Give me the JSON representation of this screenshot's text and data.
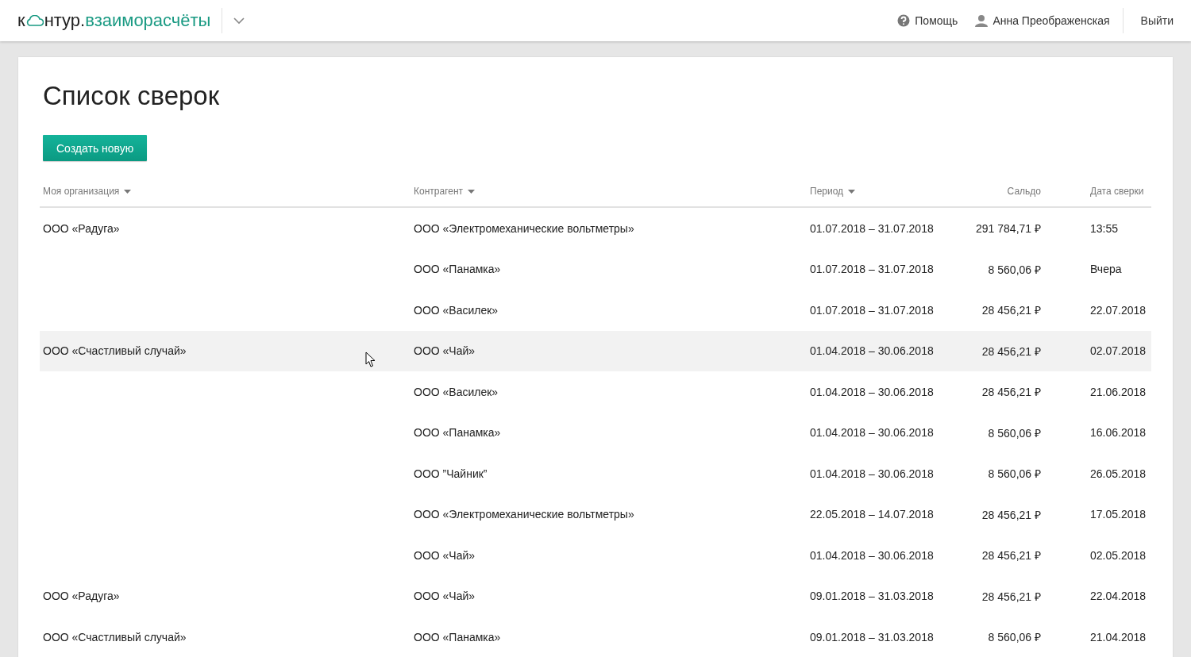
{
  "header": {
    "logo": {
      "prefix": "к",
      "rest": "нтур.",
      "product": "взаиморасчёты"
    },
    "help": "Помощь",
    "user": "Анна Преображенская",
    "logout": "Выйти"
  },
  "page": {
    "title": "Список сверок",
    "create_button": "Создать новую"
  },
  "table": {
    "columns": [
      {
        "label": "Моя организация",
        "sortable": true
      },
      {
        "label": "Контрагент",
        "sortable": true
      },
      {
        "label": "Период",
        "sortable": true
      },
      {
        "label": "Сальдо",
        "sortable": false
      },
      {
        "label": "Дата сверки",
        "sortable": false
      }
    ],
    "rows": [
      {
        "organization": "ООО «Радуга»",
        "counterparty": "ООО «Электромеханические вольтметры»",
        "period": "01.07.2018 – 31.07.2018",
        "balance": "291 784,71 ₽",
        "date": "13:55",
        "hovered": false
      },
      {
        "counterparty": "ООО «Панамка»",
        "period": "01.07.2018 – 31.07.2018",
        "balance": "8 560,06 ₽",
        "date": "Вчера",
        "hovered": false
      },
      {
        "counterparty": "ООО «Василек»",
        "period": "01.07.2018 – 31.07.2018",
        "balance": "28 456,21 ₽",
        "date": "22.07.2018",
        "hovered": false
      },
      {
        "organization": "ООО «Счастливый случай»",
        "counterparty": "ООО «Чай»",
        "period": "01.04.2018 – 30.06.2018",
        "balance": "28 456,21 ₽",
        "date": "02.07.2018",
        "hovered": true
      },
      {
        "counterparty": "ООО «Василек»",
        "period": "01.04.2018 – 30.06.2018",
        "balance": "28 456,21 ₽",
        "date": "21.06.2018",
        "hovered": false
      },
      {
        "counterparty": "ООО «Панамка»",
        "period": "01.04.2018 – 30.06.2018",
        "balance": "8 560,06 ₽",
        "date": "16.06.2018",
        "hovered": false
      },
      {
        "counterparty": "ООО ”Чайник”",
        "period": "01.04.2018 – 30.06.2018",
        "balance": "8 560,06 ₽",
        "date": "26.05.2018",
        "hovered": false
      },
      {
        "counterparty": "ООО «Электромеханические вольтметры»",
        "period": "22.05.2018 – 14.07.2018",
        "balance": "28 456,21 ₽",
        "date": "17.05.2018",
        "hovered": false
      },
      {
        "counterparty": "ООО «Чай»",
        "period": "01.04.2018 – 30.06.2018",
        "balance": "28 456,21 ₽",
        "date": "02.05.2018",
        "hovered": false
      },
      {
        "organization": "ООО «Радуга»",
        "counterparty": "ООО «Чай»",
        "period": "09.01.2018 – 31.03.2018",
        "balance": "28 456,21 ₽",
        "date": "22.04.2018",
        "hovered": false
      },
      {
        "organization": "ООО «Счастливый случай»",
        "counterparty": "ООО «Панамка»",
        "period": "09.01.2018 – 31.03.2018",
        "balance": "8 560,06 ₽",
        "date": "21.04.2018",
        "hovered": false
      }
    ]
  }
}
